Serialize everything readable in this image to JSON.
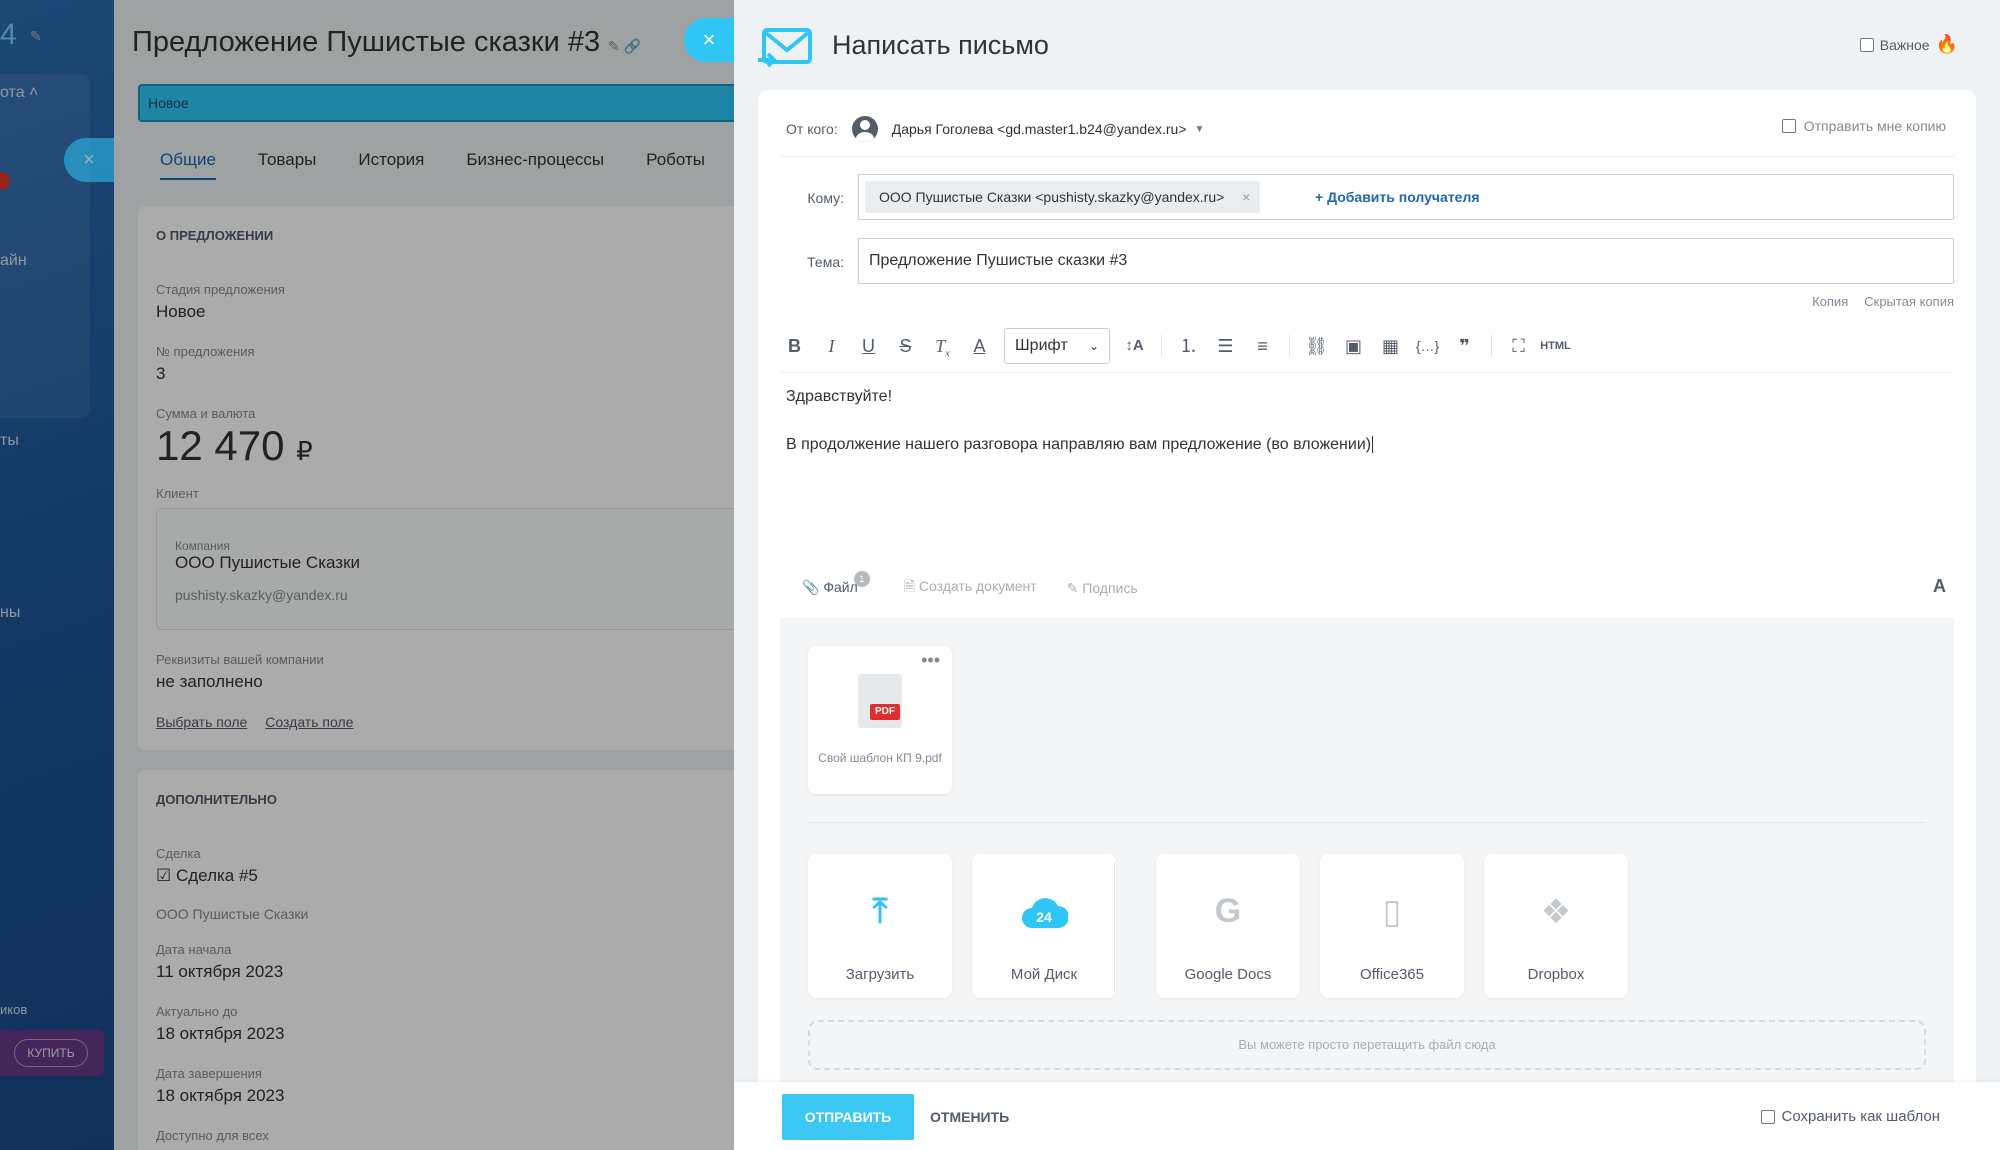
{
  "sidebar": {
    "partial_number": "4",
    "items": [
      "ота",
      "айн",
      "ты",
      "ны",
      "иков"
    ],
    "buy_label": "КУПИТЬ"
  },
  "back": {
    "title": "Предложение Пушистые сказки #3",
    "stage": "Новое",
    "tabs": [
      "Общие",
      "Товары",
      "История",
      "Бизнес-процессы",
      "Роботы"
    ],
    "about_section": "О ПРЕДЛОЖЕНИИ",
    "stage_label": "Стадия предложения",
    "stage_value": "Новое",
    "number_label": "№ предложения",
    "number_value": "3",
    "sum_label": "Сумма и валюта",
    "sum_value": "12 470",
    "currency": "₽",
    "client_label": "Клиент",
    "company_label": "Компания",
    "company_name": "ООО Пушистые Сказки",
    "company_email": "pushisty.skazky@yandex.ru",
    "requisites_label": "Реквизиты вашей компании",
    "requisites_value": "не заполнено",
    "choose_field": "Выбрать поле",
    "create_field": "Создать поле",
    "extra_section": "ДОПОЛНИТЕЛЬНО",
    "deal_label": "Сделка",
    "deal_value": "Сделка #5",
    "deal_company": "ООО Пушистые Сказки",
    "start_label": "Дата начала",
    "start_value": "11 октября 2023",
    "valid_label": "Актуально до",
    "valid_value": "18 октября 2023",
    "end_label": "Дата завершения",
    "end_value": "18 октября 2023",
    "access_label": "Доступно для всех"
  },
  "compose": {
    "title": "Написать письмо",
    "important_label": "Важное",
    "from_label": "От кого:",
    "from_value": "Дарья Гоголева <gd.master1.b24@yandex.ru>",
    "copy_me_label": "Отправить мне копию",
    "to_label": "Кому:",
    "recipient": "ООО Пушистые Сказки <pushisty.skazky@yandex.ru>",
    "add_recipient": "+ Добавить получателя",
    "subject_label": "Тема:",
    "subject_value": "Предложение Пушистые сказки #3",
    "cc_label": "Копия",
    "bcc_label": "Скрытая копия",
    "font_label": "Шрифт",
    "html_label": "HTML",
    "body_line1": "Здравствуйте!",
    "body_line2": "В продолжение нашего разговора направляю вам предложение (во вложении)",
    "attach_file": "Файл",
    "attach_count": "1",
    "create_doc": "Создать документ",
    "signature": "Подпись",
    "file_name": "Свой шаблон КП 9.pdf",
    "pdf_badge": "PDF",
    "sources": [
      {
        "label": "Загрузить",
        "icon": "upload-arrow-icon"
      },
      {
        "label": "Мой Диск",
        "icon": "cloud-24-icon"
      },
      {
        "label": "Google Docs",
        "icon": "google-icon"
      },
      {
        "label": "Office365",
        "icon": "office-icon"
      },
      {
        "label": "Dropbox",
        "icon": "dropbox-icon"
      }
    ],
    "drop_hint": "Вы можете просто перетащить файл сюда",
    "send_label": "ОТПРАВИТЬ",
    "cancel_label": "ОТМЕНИТЬ",
    "save_template_label": "Сохранить как шаблон"
  },
  "colors": {
    "accent": "#2fc6f6",
    "link": "#2067b0",
    "pdf": "#e02d2d"
  }
}
